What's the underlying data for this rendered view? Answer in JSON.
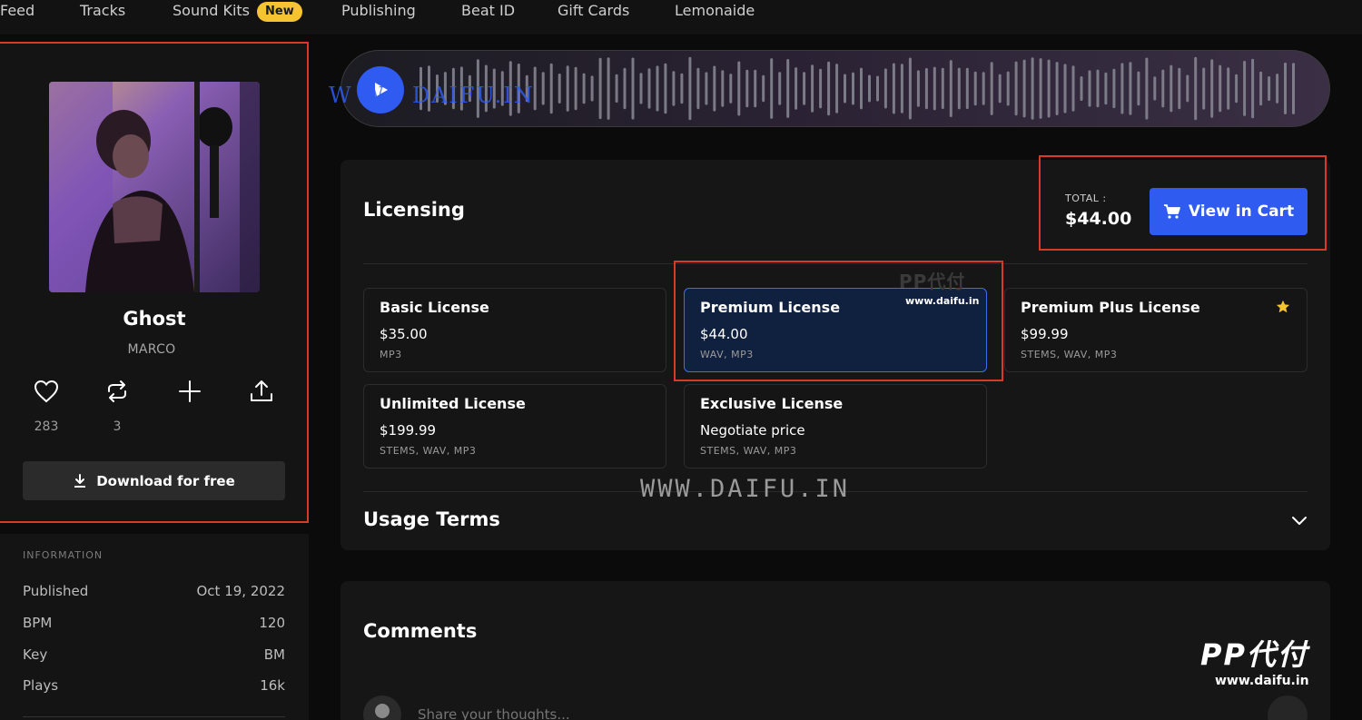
{
  "nav": {
    "items": [
      "Feed",
      "Tracks",
      "Sound Kits",
      "Publishing",
      "Beat ID",
      "Gift Cards",
      "Lemonaide"
    ],
    "badge": "New"
  },
  "track": {
    "title": "Ghost",
    "artist": "MARCO",
    "likes": "283",
    "reposts": "3",
    "download_label": "Download for free"
  },
  "information": {
    "heading": "INFORMATION",
    "rows": [
      {
        "label": "Published",
        "value": "Oct 19, 2022"
      },
      {
        "label": "BPM",
        "value": "120"
      },
      {
        "label": "Key",
        "value": "BM"
      },
      {
        "label": "Plays",
        "value": "16k"
      }
    ]
  },
  "licensing": {
    "title": "Licensing",
    "total_label": "TOTAL :",
    "total_value": "$44.00",
    "cart_label": "View in Cart",
    "licenses": [
      {
        "name": "Basic License",
        "price": "$35.00",
        "formats": "MP3",
        "selected": false
      },
      {
        "name": "Premium License",
        "price": "$44.00",
        "formats": "WAV, MP3",
        "selected": true
      },
      {
        "name": "Premium Plus License",
        "price": "$99.99",
        "formats": "STEMS, WAV, MP3",
        "selected": false
      },
      {
        "name": "Unlimited License",
        "price": "$199.99",
        "formats": "STEMS, WAV, MP3",
        "selected": false
      },
      {
        "name": "Exclusive License",
        "price": "Negotiate price",
        "formats": "STEMS, WAV, MP3",
        "selected": false
      }
    ],
    "usage_title": "Usage Terms"
  },
  "comments": {
    "title": "Comments",
    "placeholder": "Share your thoughts..."
  },
  "watermarks": {
    "top": "W W . DAIFU.IN",
    "center": "WWW.DAIFU.IN",
    "mid_brand": "PP代付",
    "mid_url": "www.daifu.in",
    "corner_brand": "PP代付",
    "corner_url": "www.daifu.in"
  },
  "colors": {
    "accent": "#2f5bf0",
    "badge": "#f6c431",
    "annotation": "#d8392b"
  }
}
